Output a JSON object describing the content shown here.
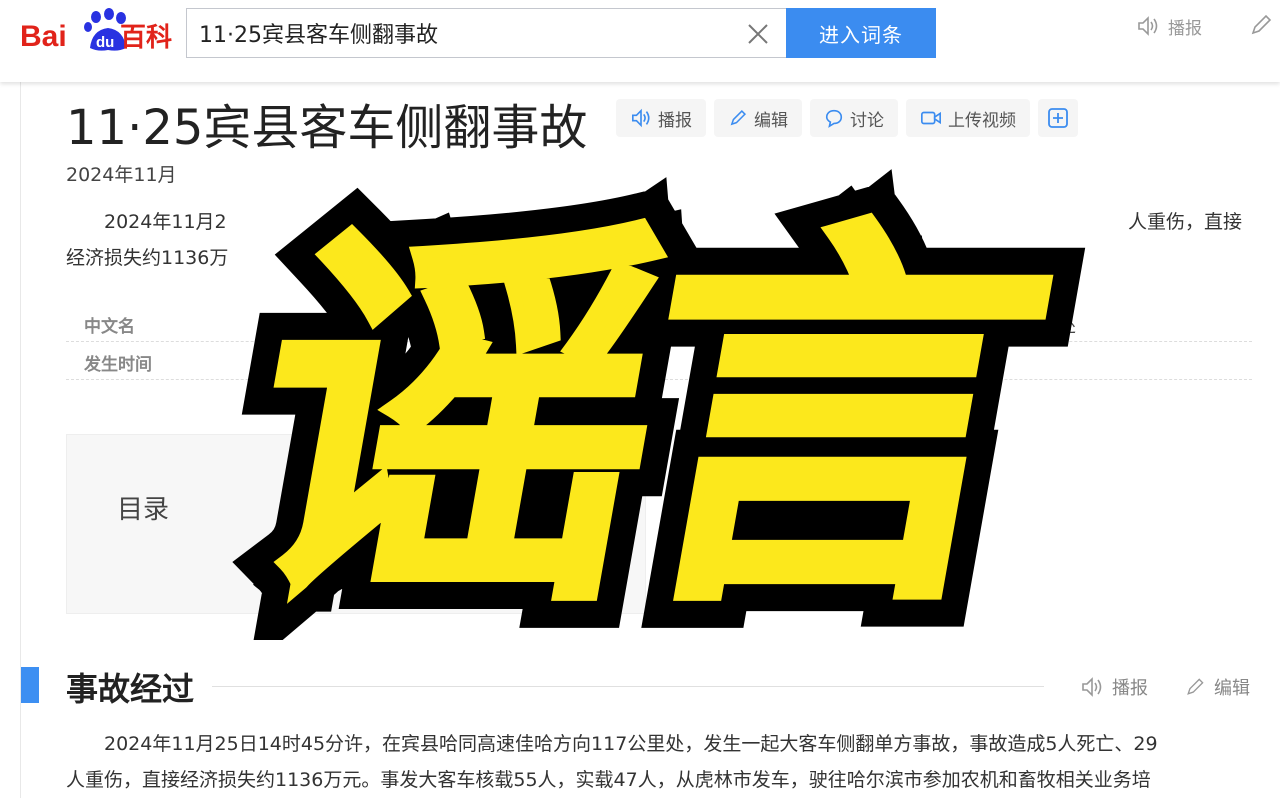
{
  "header": {
    "logo_text_1": "Bai",
    "logo_text_2": "du",
    "logo_text_3": "百科",
    "search_value": "11·25宾县客车侧翻事故",
    "enter_label": "进入词条",
    "play_label": "播报"
  },
  "article": {
    "title": "11·25宾县客车侧翻事故",
    "actions": {
      "play": "播报",
      "edit": "编辑",
      "discuss": "讨论",
      "upload_video": "上传视频"
    },
    "date": "2024年11月",
    "summary_line1_left": "2024年11月2",
    "summary_line1_right": "人重伤，直接",
    "summary_line2": "经济损失约1136万",
    "info": [
      {
        "key": "中文名",
        "value_right": "里处"
      },
      {
        "key": "发生时间",
        "value_right": ""
      }
    ],
    "toc_label": "目录"
  },
  "section": {
    "title": "事故经过",
    "play": "播报",
    "edit": "编辑",
    "line1": "2024年11月25日14时45分许，在宾县哈同高速佳哈方向117公里处，发生一起大客车侧翻单方事故，事故造成5人死亡、29",
    "line2": "人重伤，直接经济损失约1136万元。事发大客车核载55人，实载47人，从虎林市发车，驶往哈尔滨市参加农机和畜牧相关业务培"
  },
  "overlay": {
    "text": "谣言",
    "fill_color": "#fce81c",
    "outline_color": "#000000"
  },
  "colors": {
    "accent": "#3b8cf0",
    "baidu_red": "#e1231a",
    "baidu_blue": "#2932e1"
  }
}
